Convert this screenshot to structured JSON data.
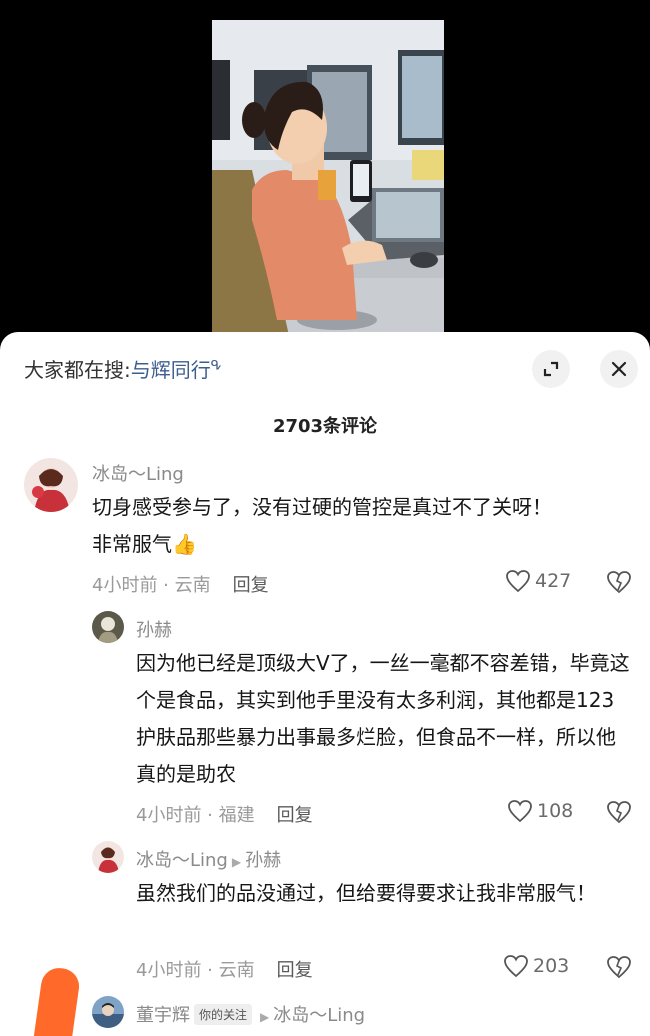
{
  "search": {
    "prefix": "大家都在搜:",
    "term": "与辉同行",
    "icon": "search-icon"
  },
  "comment_count": "2703条评论",
  "comments": [
    {
      "author": "冰岛～Ling",
      "text_line1": "切身感受参与了，没有过硬的管控是真过不了关呀！",
      "text_line2": "非常服气👍",
      "time_location": "4小时前 · 云南",
      "reply_label": "回复",
      "likes": "427"
    },
    {
      "author": "孙赫",
      "text": "因为他已经是顶级大V了，一丝一毫都不容差错，毕竟这个是食品，其实到他手里没有太多利润，其他都是123护肤品那些暴力出事最多烂脸，但食品不一样，所以他真的是助农",
      "time_location": "4小时前 · 福建",
      "reply_label": "回复",
      "likes": "108"
    },
    {
      "author": "冰岛～Ling",
      "reply_to": "孙赫",
      "text": "虽然我们的品没通过，但给要得要求让我非常服气！",
      "time_location": "4小时前 · 云南",
      "reply_label": "回复",
      "likes": "203"
    },
    {
      "author": "董宇辉",
      "badge": "你的关注",
      "reply_to": "冰岛～Ling"
    }
  ],
  "colors": {
    "link": "#3d5d8f",
    "accent_orange": "#ff6a2b"
  }
}
